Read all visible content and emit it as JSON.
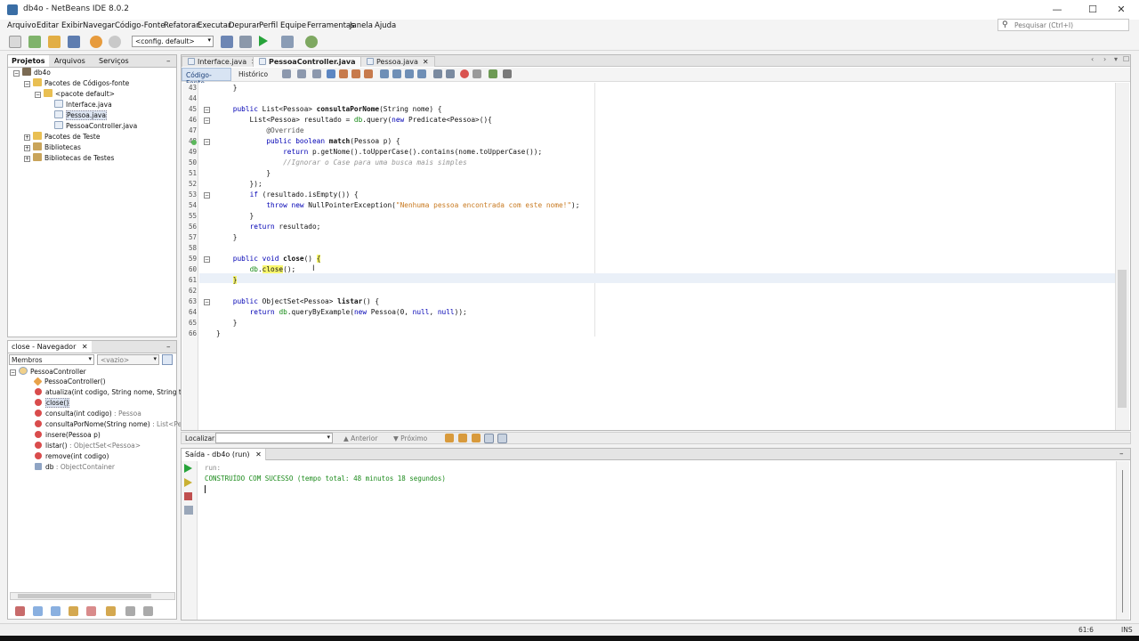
{
  "window": {
    "title": "db4o - NetBeans IDE 8.0.2"
  },
  "menu": [
    "Arquivo",
    "Editar",
    "Exibir",
    "Navegar",
    "Código-Fonte",
    "Refatorar",
    "Executar",
    "Depurar",
    "Perfil",
    "Equipe",
    "Ferramentas",
    "Janela",
    "Ajuda"
  ],
  "search": {
    "placeholder": "Pesquisar (Ctrl+I)"
  },
  "toolbar": {
    "config": "<config. default>"
  },
  "projects_panel": {
    "tabs": [
      "Projetos",
      "Arquivos",
      "Serviços"
    ],
    "tree": [
      {
        "label": "db4o",
        "icon": "project-icon",
        "level": 0
      },
      {
        "label": "Pacotes de Códigos-fonte",
        "icon": "folder-icon",
        "level": 1
      },
      {
        "label": "<pacote default>",
        "icon": "package-icon",
        "level": 2
      },
      {
        "label": "Interface.java",
        "icon": "java-file-icon",
        "level": 3
      },
      {
        "label": "Pessoa.java",
        "icon": "java-file-icon",
        "level": 3,
        "selected": true
      },
      {
        "label": "PessoaController.java",
        "icon": "java-file-icon",
        "level": 3
      },
      {
        "label": "Pacotes de Teste",
        "icon": "folder-icon",
        "level": 1
      },
      {
        "label": "Bibliotecas",
        "icon": "library-icon",
        "level": 1
      },
      {
        "label": "Bibliotecas de Testes",
        "icon": "library-icon",
        "level": 1
      }
    ]
  },
  "navigator": {
    "title": "close - Navegador",
    "filter": "Membros",
    "filter2": "<vazio>",
    "root": "PessoaController",
    "members": [
      {
        "name": "PessoaController()",
        "type": "ctor",
        "params": "",
        "ret": ""
      },
      {
        "name": "atualiza",
        "type": "method",
        "params": "(int codigo, String nome, String telefon",
        "ret": ""
      },
      {
        "name": "close()",
        "type": "method",
        "params": "",
        "ret": "",
        "selected": true
      },
      {
        "name": "consulta",
        "type": "method",
        "params": "(int codigo)",
        "ret": " : Pessoa"
      },
      {
        "name": "consultaPorNome",
        "type": "method",
        "params": "(String nome)",
        "ret": " : List<Pessoa>"
      },
      {
        "name": "insere",
        "type": "method",
        "params": "(Pessoa p)",
        "ret": ""
      },
      {
        "name": "listar()",
        "type": "method",
        "params": "",
        "ret": " : ObjectSet<Pessoa>"
      },
      {
        "name": "remove",
        "type": "method",
        "params": "(int codigo)",
        "ret": ""
      },
      {
        "name": "db",
        "type": "field",
        "params": "",
        "ret": " : ObjectContainer"
      }
    ]
  },
  "editor": {
    "tabs": [
      "Interface.java",
      "PessoaController.java",
      "Pessoa.java"
    ],
    "active_tab": 1,
    "subtabs": [
      "Código-Fonte",
      "Histórico"
    ],
    "lines": [
      {
        "n": "43",
        "html": "    }"
      },
      {
        "n": "44",
        "html": ""
      },
      {
        "n": "45",
        "html": "    <span class=\"kw\">public</span> List&lt;Pessoa&gt; <span class=\"mth\">consultaPorNome</span>(String nome) {"
      },
      {
        "n": "46",
        "html": "        List&lt;Pessoa&gt; resultado = <span class=\"fld\">db</span>.query(<span class=\"kw\">new</span> Predicate&lt;Pessoa&gt;(){"
      },
      {
        "n": "47",
        "html": "            <span class=\"ann\">@Override</span>"
      },
      {
        "n": "48",
        "html": "            <span class=\"kw\">public boolean</span> <span class=\"mth\">match</span>(Pessoa p) {"
      },
      {
        "n": "49",
        "html": "                <span class=\"kw\">return</span> p.getNome().toUpperCase().contains(nome.toUpperCase());"
      },
      {
        "n": "50",
        "html": "                <span class=\"cmt\">//Ignorar o Case para uma busca mais simples</span>"
      },
      {
        "n": "51",
        "html": "            }"
      },
      {
        "n": "52",
        "html": "        });"
      },
      {
        "n": "53",
        "html": "        <span class=\"kw\">if</span> (resultado.isEmpty()) {"
      },
      {
        "n": "54",
        "html": "            <span class=\"kw\">throw new</span> NullPointerException(<span class=\"str\">\"Nenhuma pessoa encontrada com este nome!\"</span>);"
      },
      {
        "n": "55",
        "html": "        }"
      },
      {
        "n": "56",
        "html": "        <span class=\"kw\">return</span> resultado;"
      },
      {
        "n": "57",
        "html": "    }"
      },
      {
        "n": "58",
        "html": ""
      },
      {
        "n": "59",
        "html": "    <span class=\"kw\">public void</span> <span class=\"mth\">close</span>() <span class=\"hl\">{</span>"
      },
      {
        "n": "60",
        "html": "        <span class=\"fld\">db</span>.<span class=\"hl\">close</span>();"
      },
      {
        "n": "61",
        "html": "    <span class=\"hl\">}</span>"
      },
      {
        "n": "62",
        "html": ""
      },
      {
        "n": "63",
        "html": "    <span class=\"kw\">public</span> ObjectSet&lt;Pessoa&gt; <span class=\"mth\">listar</span>() {"
      },
      {
        "n": "64",
        "html": "        <span class=\"kw\">return</span> <span class=\"fld\">db</span>.queryByExample(<span class=\"kw\">new</span> Pessoa(0, <span class=\"kw\">null</span>, <span class=\"kw\">null</span>));"
      },
      {
        "n": "65",
        "html": "    }"
      },
      {
        "n": "66",
        "html": "}"
      }
    ]
  },
  "findbar": {
    "label": "Localizar:",
    "prev": "Anterior",
    "next": "Próximo"
  },
  "output": {
    "tab": "Saída - db4o (run)",
    "lines": [
      "run:",
      "CONSTRUÍDO COM SUCESSO (tempo total: 48 minutos 18 segundos)"
    ]
  },
  "status": {
    "position": "61:6",
    "mode": "INS"
  }
}
